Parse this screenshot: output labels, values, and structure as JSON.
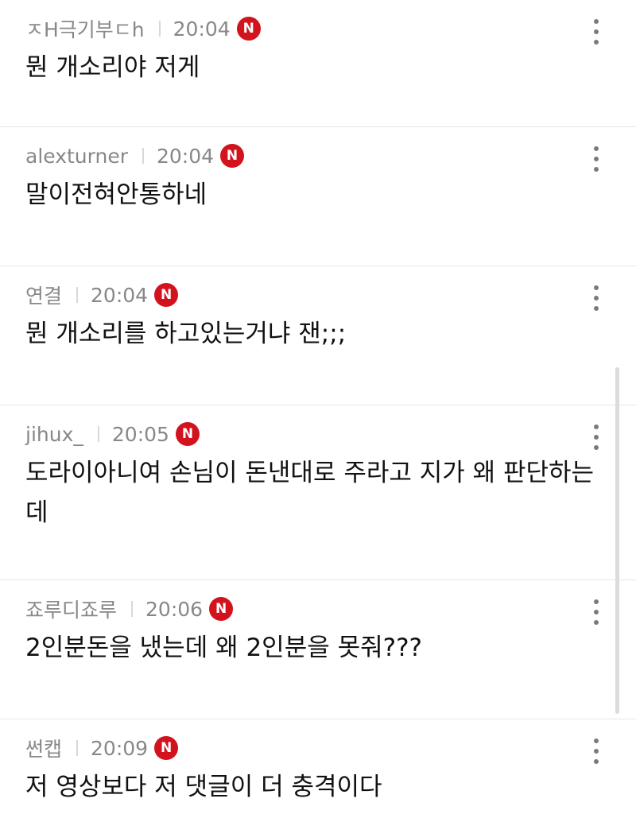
{
  "comments": [
    {
      "author": "ㅈH극기부ㄷh",
      "time": "20:04",
      "badge": "N",
      "text": "뭔 개소리야 저게"
    },
    {
      "author": "alexturner",
      "time": "20:04",
      "badge": "N",
      "text": "말이전혀안통하네"
    },
    {
      "author": "연결",
      "time": "20:04",
      "badge": "N",
      "text": "뭔 개소리를 하고있는거냐 잰;;;"
    },
    {
      "author": "jihux_",
      "time": "20:05",
      "badge": "N",
      "text": "도라이아니여 손님이 돈낸대로 주라고 지가 왜 판단하는데"
    },
    {
      "author": "죠루디죠루",
      "time": "20:06",
      "badge": "N",
      "text": "2인분돈을 냈는데 왜 2인분을 못줘???"
    },
    {
      "author": "썬캡",
      "time": "20:09",
      "badge": "N",
      "text": "저 영상보다 저 댓글이 더 충격이다"
    }
  ],
  "icons": {
    "more": "more-vertical-icon",
    "new_badge_color": "#d2121c"
  }
}
